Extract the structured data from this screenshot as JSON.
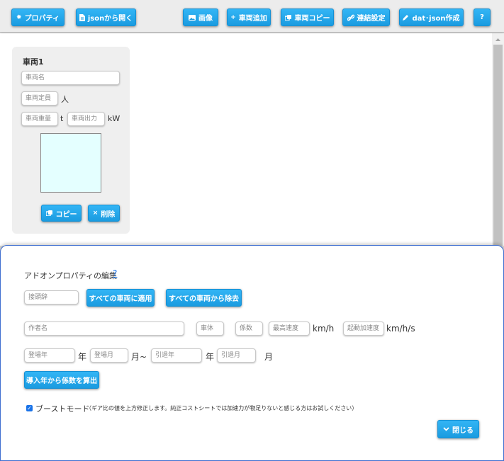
{
  "toolbar": {
    "property_label": "プロパティ",
    "open_json_label": "jsonから開く",
    "image_label": "画像",
    "add_vehicle_label": "車両追加",
    "copy_vehicle_label": "車両コピー",
    "coupling_label": "連結設定",
    "dat_json_label": "dat･json作成",
    "help_label": "?"
  },
  "vehicle_card": {
    "title": "車両1",
    "name_placeholder": "車両名",
    "capacity_placeholder": "車両定員",
    "capacity_unit": "人",
    "weight_placeholder": "車両重量",
    "weight_unit": "t",
    "power_placeholder": "車両出力",
    "power_unit": "kW",
    "copy_label": "コピー",
    "delete_label": "削除"
  },
  "addon_panel": {
    "title": "アドオンプロパティの編集",
    "help_link": "?",
    "prefix_placeholder": "接頭辞",
    "apply_all_label": "すべての車両に適用",
    "remove_all_label": "すべての車両から除去",
    "author_placeholder": "作者名",
    "body_placeholder": "車体",
    "coefficient_placeholder": "係数",
    "max_speed_placeholder": "最高速度",
    "max_speed_unit": "km/h",
    "acceleration_placeholder": "起動加速度",
    "acceleration_unit": "km/h/s",
    "intro_year_placeholder": "登場年",
    "year_unit": "年",
    "intro_month_placeholder": "登場月",
    "month_tilde": "月~",
    "retire_year_placeholder": "引退年",
    "retire_year_unit": "年",
    "retire_month_placeholder": "引退月",
    "month_unit": "月",
    "calc_coefficient_label": "導入年から係数を算出",
    "boost_mode_label": "ブーストモード",
    "boost_mode_checked": true,
    "boost_mode_note": "（ギア比の値を上方修正します。純正コストシートでは加速力が物足りないと感じる方はお試しください）",
    "close_label": "閉じる"
  },
  "colors": {
    "accent": "#1a9be0",
    "preview_bg": "#e4ffff",
    "panel_border": "#3f6fd0"
  }
}
